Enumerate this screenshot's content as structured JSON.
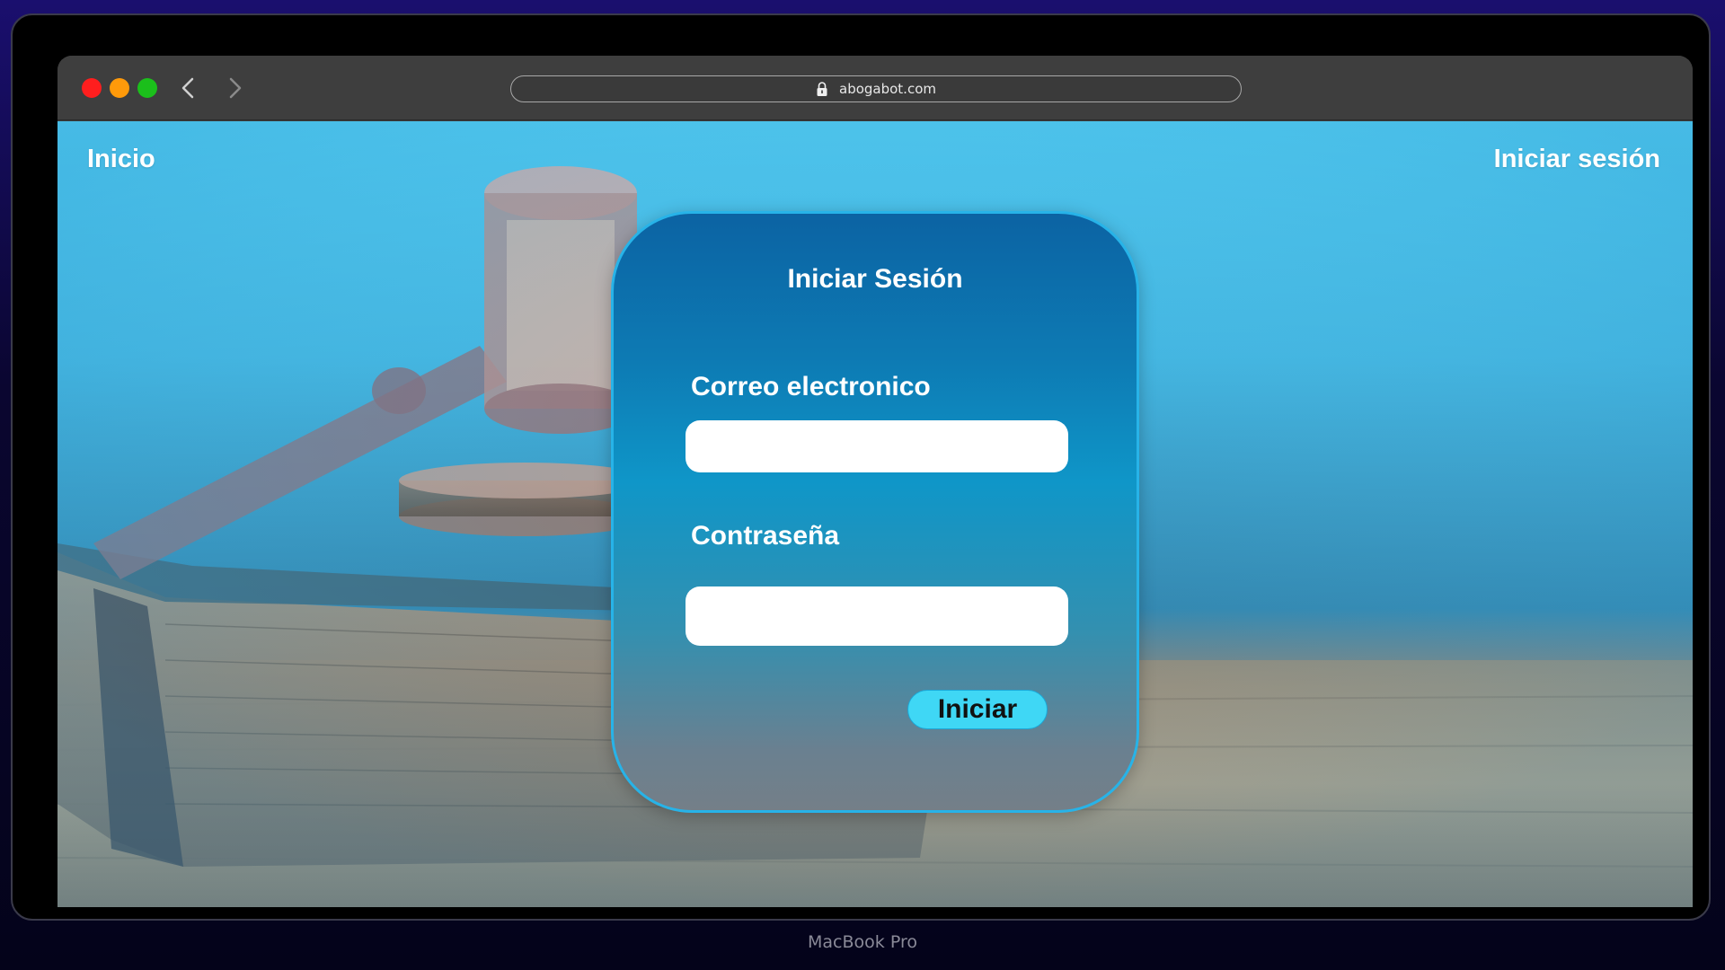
{
  "browser": {
    "url": "abogabot.com",
    "traffic_lights": [
      "close",
      "minimize",
      "maximize"
    ],
    "colors": {
      "close": "#ff1e1e",
      "minimize": "#ff9a0a",
      "maximize": "#1bbf1b"
    }
  },
  "nav": {
    "home_label": "Inicio",
    "login_label": "Iniciar sesión"
  },
  "login_card": {
    "title": "Iniciar Sesión",
    "email_label": "Correo electronico",
    "email_value": "",
    "password_label": "Contraseña",
    "password_value": "",
    "submit_label": "Iniciar"
  },
  "background": {
    "description_icons": [
      "gavel-image",
      "book-image"
    ]
  },
  "device": {
    "label": "MacBook Pro"
  },
  "theme": {
    "accent": "#3fd7f5",
    "card_border": "#27b3e8",
    "sky_blue": "#4cc6ee"
  }
}
